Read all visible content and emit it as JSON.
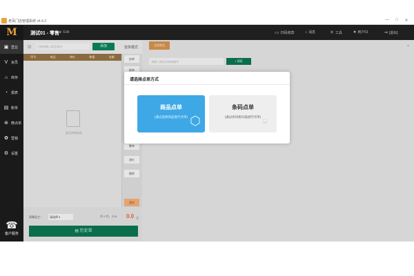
{
  "window": {
    "title": "老百门店管理系统 v4.4.2",
    "controls": [
      "—",
      "□",
      "✕"
    ]
  },
  "topbar": {
    "logo": "M",
    "shop_name": "测试01 - 零售",
    "vip": "♛ SVA",
    "right": [
      {
        "icon": "screen-icon",
        "glyph": "▭",
        "label": "扫码收款"
      },
      {
        "icon": "bell-icon",
        "glyph": "🔔",
        "label": "消息"
      },
      {
        "icon": "tools-icon",
        "glyph": "✕",
        "label": "工具"
      },
      {
        "icon": "user-icon",
        "glyph": "👤",
        "label": "用户01"
      },
      {
        "icon": "exit-icon",
        "glyph": "⇥",
        "label": "[退出]"
      }
    ]
  },
  "sidebar": {
    "items": [
      {
        "label": "营业",
        "glyph": "🛍",
        "icon": "bag-icon"
      },
      {
        "label": "会员",
        "glyph": "V",
        "icon": "vip-icon"
      },
      {
        "label": "库存",
        "glyph": "⌂",
        "icon": "store-icon"
      },
      {
        "label": "报表",
        "glyph": "◔",
        "icon": "report-icon"
      },
      {
        "label": "账单",
        "glyph": "▤",
        "icon": "bill-icon"
      },
      {
        "label": "微点单",
        "glyph": "⊛",
        "icon": "wechat-icon"
      },
      {
        "label": "营销",
        "glyph": "✿",
        "icon": "marketing-icon"
      },
      {
        "label": "设置",
        "glyph": "⚙",
        "icon": "settings-icon"
      }
    ],
    "service_label": "客户服务"
  },
  "left": {
    "scan_placeholder": "扫描或输入商品条码",
    "add_button": "添加",
    "mode_label": "挂单模式",
    "columns": [
      "序号",
      "商品",
      "单价",
      "数量",
      "金额"
    ],
    "empty_text": "暂无待结商品",
    "side_buttons": [
      "挂单",
      "取单",
      "整单",
      "改价",
      "删除"
    ],
    "clear_button": "清空",
    "clerk_label": "导购员工：",
    "clerk_value": "请选择",
    "totals": "共 0 件，小计",
    "total_amount": "0.0",
    "total_unit": "元",
    "history_button": "历史单"
  },
  "right": {
    "tab": "全部商品",
    "search_placeholder": "请输入商品名称或编号",
    "search_button": "搜索"
  },
  "modal": {
    "title": "请选择点单方式",
    "product_title": "商品点单",
    "product_sub": "(通过选择商品进行点单)",
    "barcode_title": "条码点单",
    "barcode_sub": "(通过条码枪扫描进行点单)"
  }
}
